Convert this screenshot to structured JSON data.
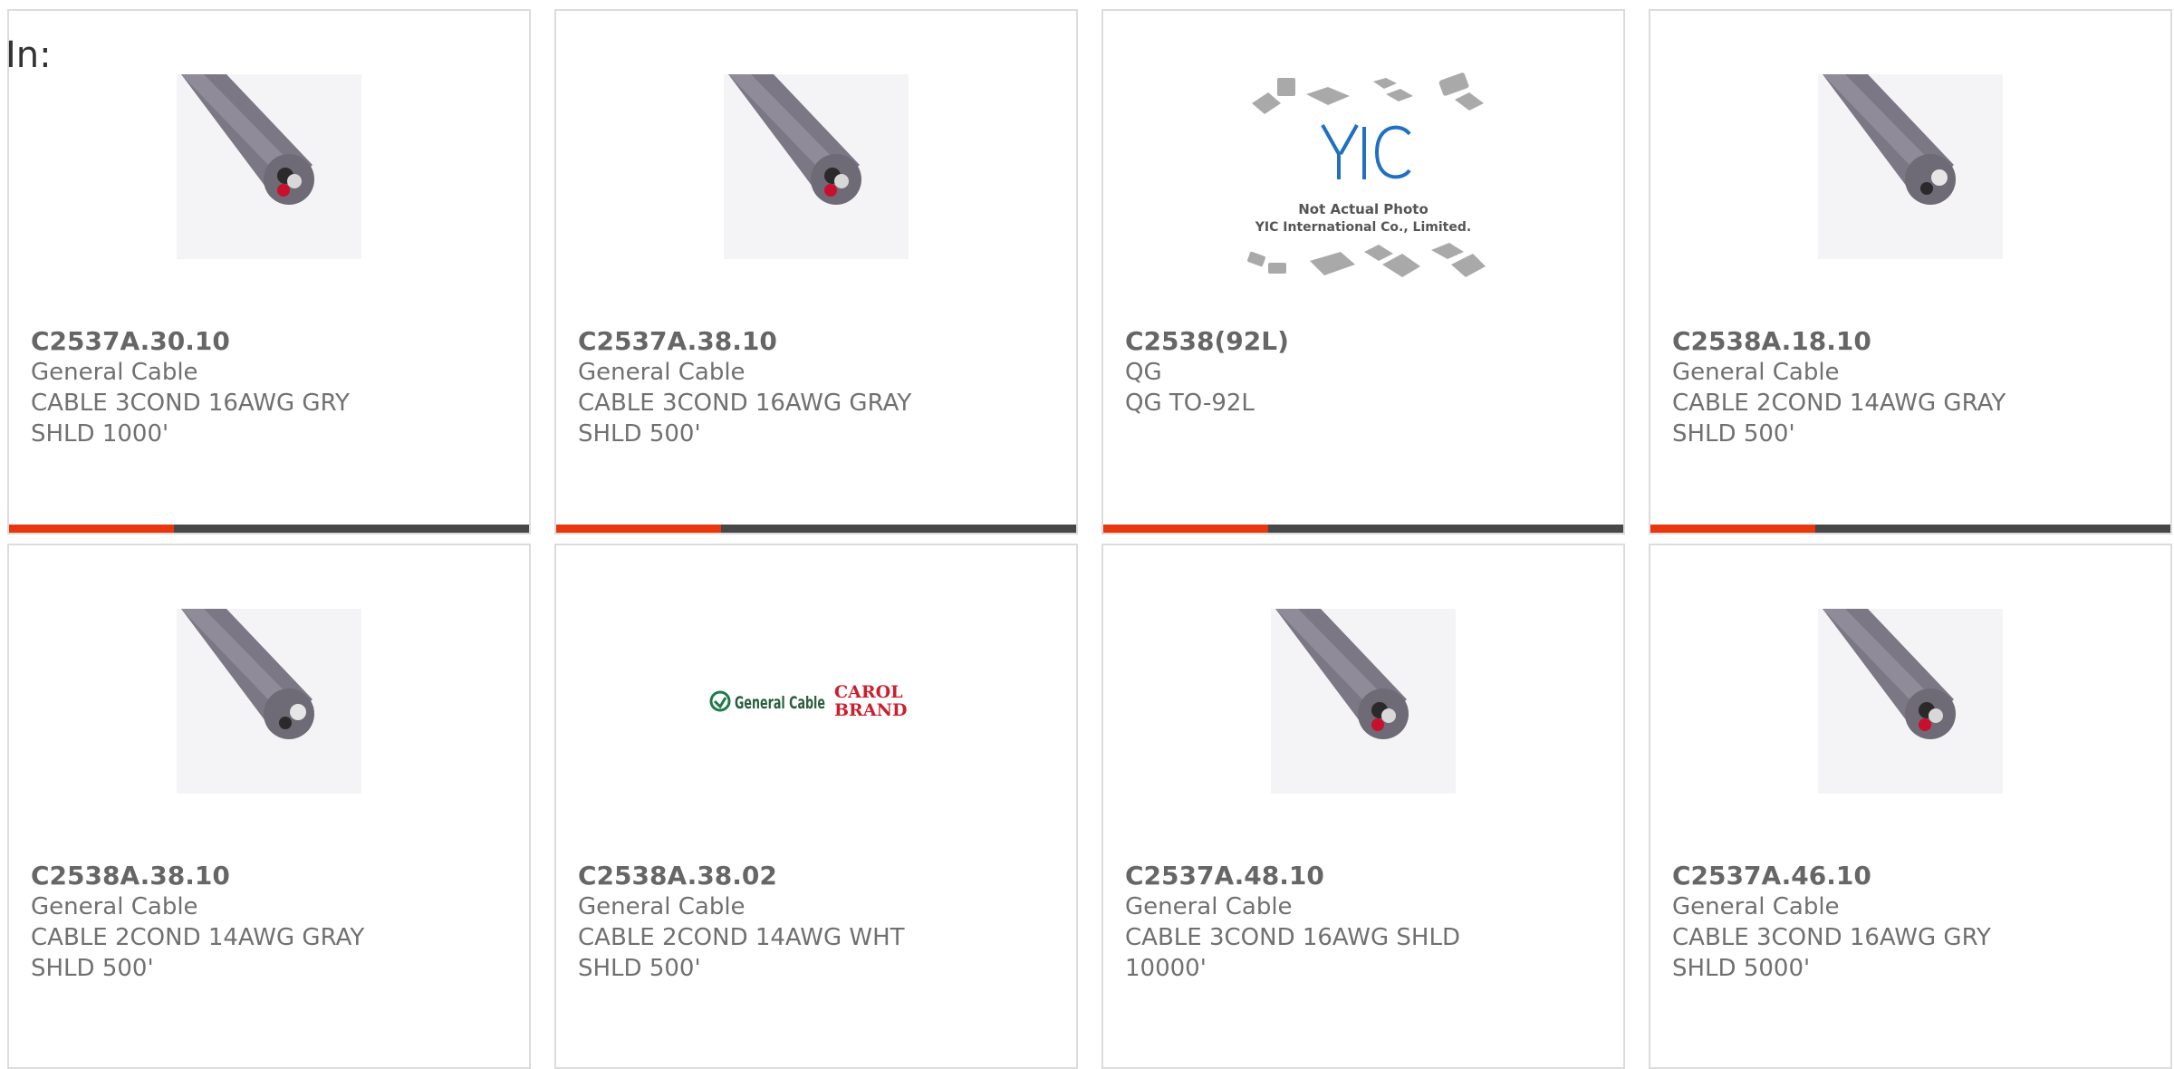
{
  "header": {
    "filter_label": "In:"
  },
  "products": [
    {
      "part": "C2537A.30.10",
      "manufacturer": "General Cable",
      "description": "CABLE 3COND 16AWG GRY SHLD 1000'",
      "image": "cable-3cond-photo"
    },
    {
      "part": "C2537A.38.10",
      "manufacturer": "General Cable",
      "description": "CABLE 3COND 16AWG GRAY SHLD 500'",
      "image": "cable-3cond-photo"
    },
    {
      "part": "C2538(92L)",
      "manufacturer": "QG",
      "description": "QG TO-92L",
      "image": "yic-placeholder-photo",
      "image_text": [
        "YIC",
        "Not Actual Photo",
        "YIC International Co., Limited."
      ]
    },
    {
      "part": "C2538A.18.10",
      "manufacturer": "General Cable",
      "description": "CABLE 2COND 14AWG GRAY SHLD 500'",
      "image": "cable-2cond-photo"
    },
    {
      "part": "C2538A.38.10",
      "manufacturer": "General Cable",
      "description": "CABLE 2COND 14AWG GRAY SHLD 500'",
      "image": "cable-2cond-photo"
    },
    {
      "part": "C2538A.38.02",
      "manufacturer": "General Cable",
      "description": "CABLE 2COND 14AWG WHT SHLD 500'",
      "image": "brand-logo",
      "image_text": [
        "General Cable",
        "CAROL",
        "BRAND"
      ]
    },
    {
      "part": "C2537A.48.10",
      "manufacturer": "General Cable",
      "description": "CABLE 3COND 16AWG SHLD 10000'",
      "image": "cable-3cond-photo"
    },
    {
      "part": "C2537A.46.10",
      "manufacturer": "General Cable",
      "description": "CABLE 3COND 16AWG GRY SHLD 5000'",
      "image": "cable-3cond-photo"
    }
  ],
  "colors": {
    "accent": "#e8360e",
    "bar": "#474747",
    "text": "#666666",
    "border": "#dcdcdc"
  }
}
